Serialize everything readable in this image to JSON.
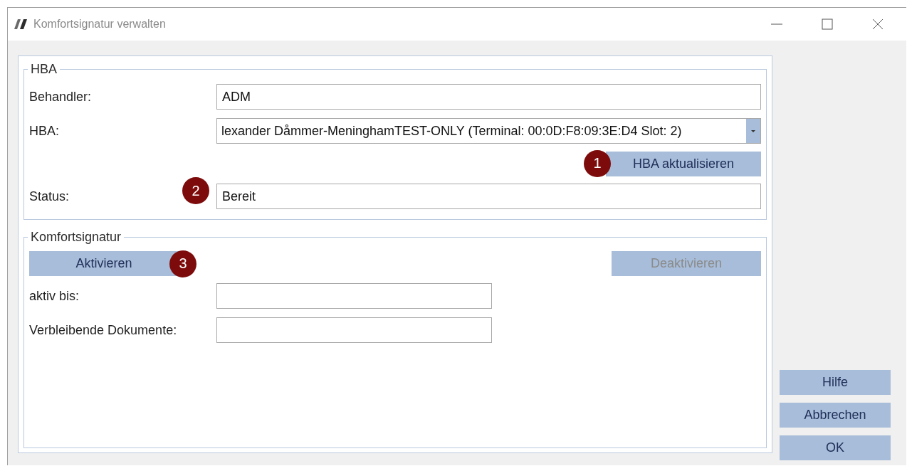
{
  "window": {
    "title": "Komfortsignatur verwalten"
  },
  "hba_group": {
    "title": "HBA",
    "behandler": {
      "label": "Behandler:",
      "value": "ADM"
    },
    "hba": {
      "label": "HBA:",
      "value": "lexander Dåmmer-MeninghamTEST-ONLY (Terminal: 00:0D:F8:09:3E:D4 Slot: 2)"
    },
    "refresh_button": {
      "label": "HBA aktualisieren",
      "disabled": false,
      "badge": "1"
    },
    "status": {
      "label": "Status:",
      "value": "Bereit",
      "badge": "2"
    }
  },
  "komfort_group": {
    "title": "Komfortsignatur",
    "activate_button": {
      "label": "Aktivieren",
      "disabled": false,
      "badge": "3"
    },
    "deactivate_button": {
      "label": "Deaktivieren",
      "disabled": true
    },
    "aktiv_bis": {
      "label": "aktiv bis:"
    },
    "remaining": {
      "label": "Verbleibende Dokumente:"
    }
  },
  "buttons": [
    {
      "label": "Hilfe",
      "disabled": false
    },
    {
      "label": "Abbrechen",
      "disabled": false
    },
    {
      "label": "OK",
      "disabled": false
    }
  ]
}
